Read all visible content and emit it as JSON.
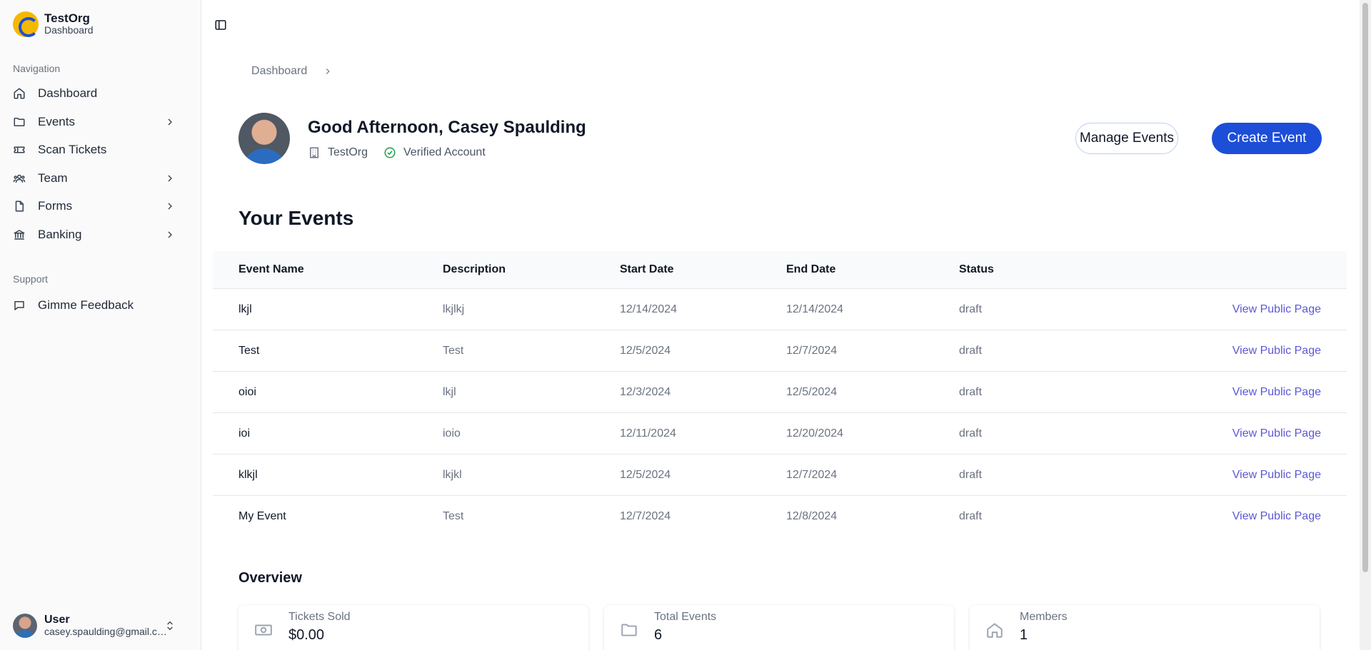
{
  "org": {
    "name": "TestOrg",
    "subtitle": "Dashboard"
  },
  "sidebar": {
    "navigation_label": "Navigation",
    "items": [
      {
        "label": "Dashboard",
        "icon": "home-icon"
      },
      {
        "label": "Events",
        "icon": "folder-icon",
        "expandable": true
      },
      {
        "label": "Scan Tickets",
        "icon": "ticket-icon"
      },
      {
        "label": "Team",
        "icon": "team-icon",
        "expandable": true
      },
      {
        "label": "Forms",
        "icon": "file-icon",
        "expandable": true
      },
      {
        "label": "Banking",
        "icon": "bank-icon",
        "expandable": true
      }
    ],
    "support_label": "Support",
    "support_items": [
      {
        "label": "Gimme Feedback",
        "icon": "message-icon"
      }
    ]
  },
  "user": {
    "name": "User",
    "email": "casey.spaulding@gmail.com"
  },
  "breadcrumb": {
    "items": [
      "Dashboard"
    ]
  },
  "profile": {
    "greeting": "Good Afternoon, Casey Spaulding",
    "org": "TestOrg",
    "verified": "Verified Account"
  },
  "actions": {
    "manage": "Manage Events",
    "create": "Create Event"
  },
  "events": {
    "title": "Your Events",
    "columns": [
      "Event Name",
      "Description",
      "Start Date",
      "End Date",
      "Status"
    ],
    "link_label": "View Public Page",
    "rows": [
      {
        "name": "lkjl",
        "description": "lkjlkj",
        "start": "12/14/2024",
        "end": "12/14/2024",
        "status": "draft"
      },
      {
        "name": "Test",
        "description": "Test",
        "start": "12/5/2024",
        "end": "12/7/2024",
        "status": "draft"
      },
      {
        "name": "oioi",
        "description": "lkjl",
        "start": "12/3/2024",
        "end": "12/5/2024",
        "status": "draft"
      },
      {
        "name": "ioi",
        "description": "ioio",
        "start": "12/11/2024",
        "end": "12/20/2024",
        "status": "draft"
      },
      {
        "name": "klkjl",
        "description": "lkjkl",
        "start": "12/5/2024",
        "end": "12/7/2024",
        "status": "draft"
      },
      {
        "name": "My Event",
        "description": "Test",
        "start": "12/7/2024",
        "end": "12/8/2024",
        "status": "draft"
      }
    ]
  },
  "overview": {
    "title": "Overview",
    "cards": [
      {
        "label": "Tickets Sold",
        "value": "$0.00",
        "icon": "money-icon"
      },
      {
        "label": "Total Events",
        "value": "6",
        "icon": "folder-icon"
      },
      {
        "label": "Members",
        "value": "1",
        "icon": "home-icon"
      }
    ]
  },
  "colors": {
    "primary": "#1d4ed8",
    "link": "#5b57d6",
    "logo": "#f5b800"
  }
}
